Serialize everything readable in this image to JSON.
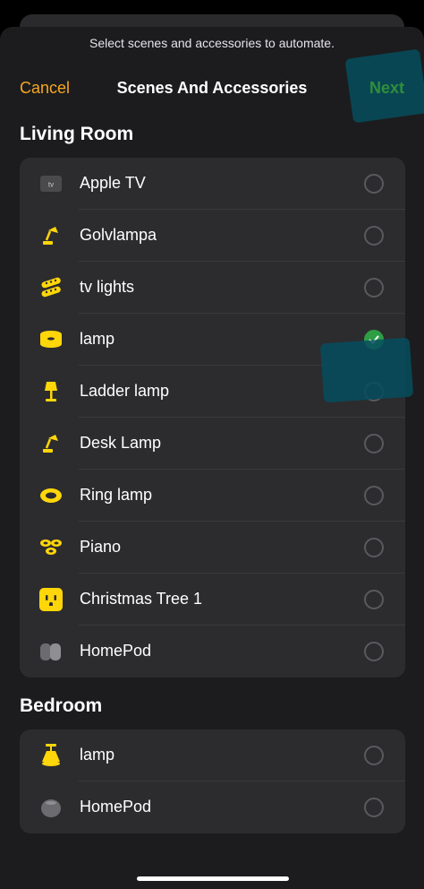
{
  "sheet": {
    "subtitle": "Select scenes and accessories to automate.",
    "cancel_label": "Cancel",
    "title": "Scenes And Accessories",
    "next_label": "Next"
  },
  "colors": {
    "accent": "#f5a623",
    "next": "#2f8f3a",
    "checked": "#2e9e45",
    "highlight": "#064e5e"
  },
  "sections": [
    {
      "title": "Living Room",
      "items": [
        {
          "label": "Apple TV",
          "icon": "apple-tv-icon",
          "selected": false
        },
        {
          "label": "Golvlampa",
          "icon": "desk-lamp-icon",
          "selected": false
        },
        {
          "label": "tv lights",
          "icon": "light-strip-icon",
          "selected": false
        },
        {
          "label": "lamp",
          "icon": "ceiling-light-icon",
          "selected": true
        },
        {
          "label": "Ladder lamp",
          "icon": "floor-lamp-icon",
          "selected": false
        },
        {
          "label": "Desk Lamp",
          "icon": "desk-lamp-icon",
          "selected": false
        },
        {
          "label": "Ring lamp",
          "icon": "ring-light-icon",
          "selected": false
        },
        {
          "label": "Piano",
          "icon": "spotlights-icon",
          "selected": false
        },
        {
          "label": "Christmas Tree 1",
          "icon": "outlet-icon",
          "selected": false
        },
        {
          "label": "HomePod",
          "icon": "homepod-pair-icon",
          "selected": false
        }
      ]
    },
    {
      "title": "Bedroom",
      "items": [
        {
          "label": "lamp",
          "icon": "pendant-lamp-icon",
          "selected": false
        },
        {
          "label": "HomePod",
          "icon": "homepod-mini-icon",
          "selected": false
        }
      ]
    }
  ]
}
